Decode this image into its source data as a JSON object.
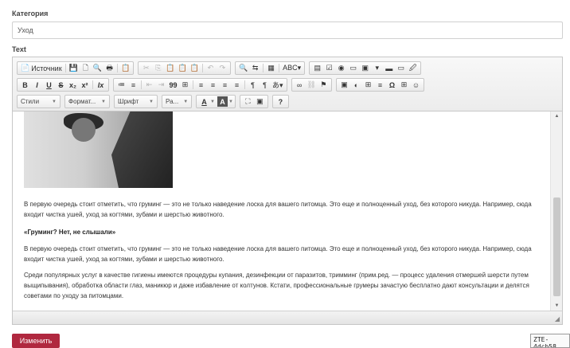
{
  "form": {
    "category_label": "Категория",
    "category_value": "Уход",
    "text_label": "Text",
    "submit_label": "Изменить"
  },
  "toolbar": {
    "row1": {
      "source_label": "Источник",
      "source_icon": "📄",
      "g1": [
        "💾",
        "🗋",
        "🔍",
        "🖶",
        "📋"
      ],
      "g2": [
        "✂",
        "⎘",
        "📋",
        "📋",
        "📋"
      ],
      "g2_dim": [
        true,
        true,
        false,
        false,
        false
      ],
      "g3": [
        "↶",
        "↷"
      ],
      "g4": [
        "🔍",
        "⇆",
        "|",
        "▦",
        "|",
        "ABC▾"
      ],
      "g5": [
        "▤",
        "☑",
        "◉",
        "▭",
        "▣",
        "▾",
        "▬",
        "▭",
        "🖉"
      ]
    },
    "row2": {
      "g1": [
        "B",
        "I",
        "U",
        "S",
        "x₂",
        "x²",
        "Ix"
      ],
      "g2": [
        "≔",
        "≡",
        "⇤",
        "⇥",
        "99",
        "⊞",
        "≡",
        "≡",
        "≡",
        "≡",
        "¶",
        "¶",
        "あ▾"
      ],
      "g3": [
        "∞",
        "⛓",
        "⚑"
      ],
      "g4": [
        "▣",
        "◐",
        "⊞",
        "≡",
        "Ω",
        "⊞",
        "☺"
      ]
    },
    "row3": {
      "styles": "Стили",
      "format": "Формат...",
      "font": "Шрифт",
      "size": "Ра...",
      "text_color": "A",
      "bg_color": "A",
      "maximize": "⛶",
      "blocks": "▣",
      "help": "?"
    }
  },
  "content": {
    "paragraphs": [
      "В первую очередь стоит отметить, что груминг — это не только наведение лоска для вашего питомца. Это еще и полноценный уход, без которого никуда. Например, сюда входит чистка ушей, уход за когтями, зубами и шерстью животного.",
      "«Груминг? Нет, не слышали»",
      "В первую очередь стоит отметить, что груминг — это не только наведение лоска для вашего питомца. Это еще и полноценный уход, без которого никуда. Например, сюда входит чистка ушей, уход за когтями, зубами и шерстью животного.",
      "Среди популярных услуг в качестве гигиены имеются процедуры купания, дезинфекции от паразитов, тримминг (прим.ред. — процесс удаления отмершей шерсти путем выщипывания), обработка области глаз, маникюр и даже избавление от колтунов. Кстати, профессиональные грумеры зачастую бесплатно дают консультации и делятся советами по уходу за питомцами."
    ]
  },
  "scrollbar": {
    "up": "▲",
    "down": "▼",
    "position": 0.55
  },
  "statusbar": {
    "grip": "◢"
  },
  "tooltip": {
    "text": "ZTE-4dcb58"
  }
}
